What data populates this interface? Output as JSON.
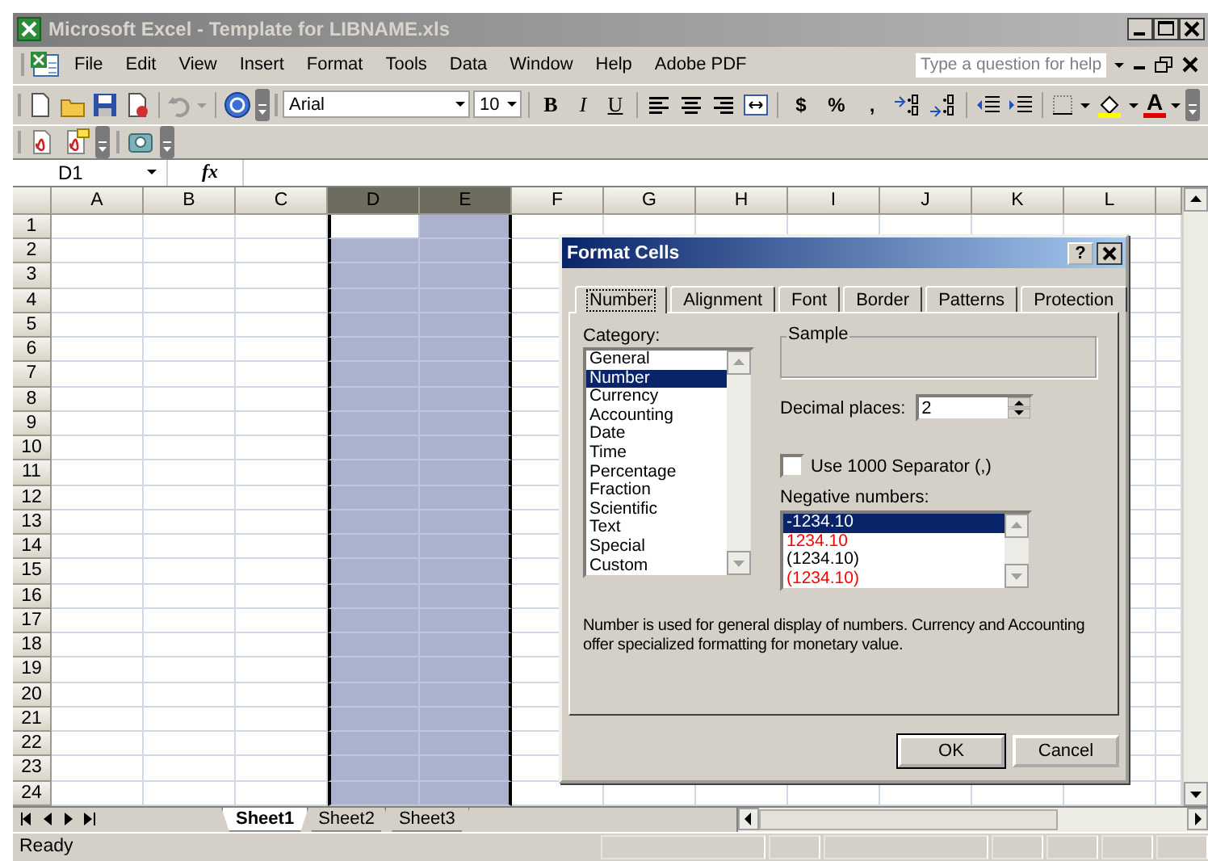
{
  "window": {
    "title": "Microsoft Excel - Template for LIBNAME.xls"
  },
  "menu": [
    {
      "label": "File"
    },
    {
      "label": "Edit"
    },
    {
      "label": "View"
    },
    {
      "label": "Insert"
    },
    {
      "label": "Format"
    },
    {
      "label": "Tools"
    },
    {
      "label": "Data"
    },
    {
      "label": "Window"
    },
    {
      "label": "Help"
    },
    {
      "label": "Adobe PDF"
    }
  ],
  "help_box": {
    "placeholder": "Type a question for help"
  },
  "formatting": {
    "font": "Arial",
    "size": "10",
    "styles": [
      "B",
      "I",
      "U"
    ],
    "number_formats": [
      "$",
      "%",
      ","
    ],
    "font_color_glyph": "A"
  },
  "formula_bar": {
    "name_box": "D1",
    "function_label": "fx"
  },
  "columns": [
    {
      "label": "A",
      "selected": false
    },
    {
      "label": "B",
      "selected": false
    },
    {
      "label": "C",
      "selected": false
    },
    {
      "label": "D",
      "selected": true
    },
    {
      "label": "E",
      "selected": true
    },
    {
      "label": "F",
      "selected": false
    },
    {
      "label": "G",
      "selected": false
    },
    {
      "label": "H",
      "selected": false
    },
    {
      "label": "I",
      "selected": false
    },
    {
      "label": "J",
      "selected": false
    },
    {
      "label": "K",
      "selected": false
    },
    {
      "label": "L",
      "selected": false
    }
  ],
  "rows": [
    "1",
    "2",
    "3",
    "4",
    "5",
    "6",
    "7",
    "8",
    "9",
    "10",
    "11",
    "12",
    "13",
    "14",
    "15",
    "16",
    "17",
    "18",
    "19",
    "20",
    "21",
    "22",
    "23",
    "24"
  ],
  "sheet_tabs": [
    {
      "label": "Sheet1",
      "selected": true
    },
    {
      "label": "Sheet2",
      "selected": false
    },
    {
      "label": "Sheet3",
      "selected": false
    }
  ],
  "status_bar": {
    "text": "Ready"
  },
  "dialog": {
    "title": "Format Cells",
    "help_glyph": "?",
    "tabs": [
      {
        "label": "Number",
        "selected": true
      },
      {
        "label": "Alignment",
        "selected": false
      },
      {
        "label": "Font",
        "selected": false
      },
      {
        "label": "Border",
        "selected": false
      },
      {
        "label": "Patterns",
        "selected": false
      },
      {
        "label": "Protection",
        "selected": false
      }
    ],
    "category_label": "Category:",
    "categories": [
      {
        "label": "General",
        "selected": false
      },
      {
        "label": "Number",
        "selected": true
      },
      {
        "label": "Currency",
        "selected": false
      },
      {
        "label": "Accounting",
        "selected": false
      },
      {
        "label": "Date",
        "selected": false
      },
      {
        "label": "Time",
        "selected": false
      },
      {
        "label": "Percentage",
        "selected": false
      },
      {
        "label": "Fraction",
        "selected": false
      },
      {
        "label": "Scientific",
        "selected": false
      },
      {
        "label": "Text",
        "selected": false
      },
      {
        "label": "Special",
        "selected": false
      },
      {
        "label": "Custom",
        "selected": false
      }
    ],
    "sample_label": "Sample",
    "decimal_label": "Decimal places:",
    "decimal_value": "2",
    "separator": {
      "label": "Use 1000 Separator (,)",
      "checked": false
    },
    "negative_label": "Negative numbers:",
    "negatives": [
      {
        "label": "-1234.10",
        "selected": true
      },
      {
        "label": "1234.10",
        "selected": false,
        "color": "#ff0000"
      },
      {
        "label": "(1234.10)",
        "selected": false,
        "color": "#000000"
      },
      {
        "label": "(1234.10)",
        "selected": false,
        "color": "#ff0000"
      }
    ],
    "description": "Number is used for general display of numbers.  Currency and Accounting offer specialized formatting for monetary value.",
    "buttons": [
      {
        "label": "OK",
        "kind": "default"
      },
      {
        "label": "Cancel",
        "kind": "normal"
      }
    ]
  }
}
